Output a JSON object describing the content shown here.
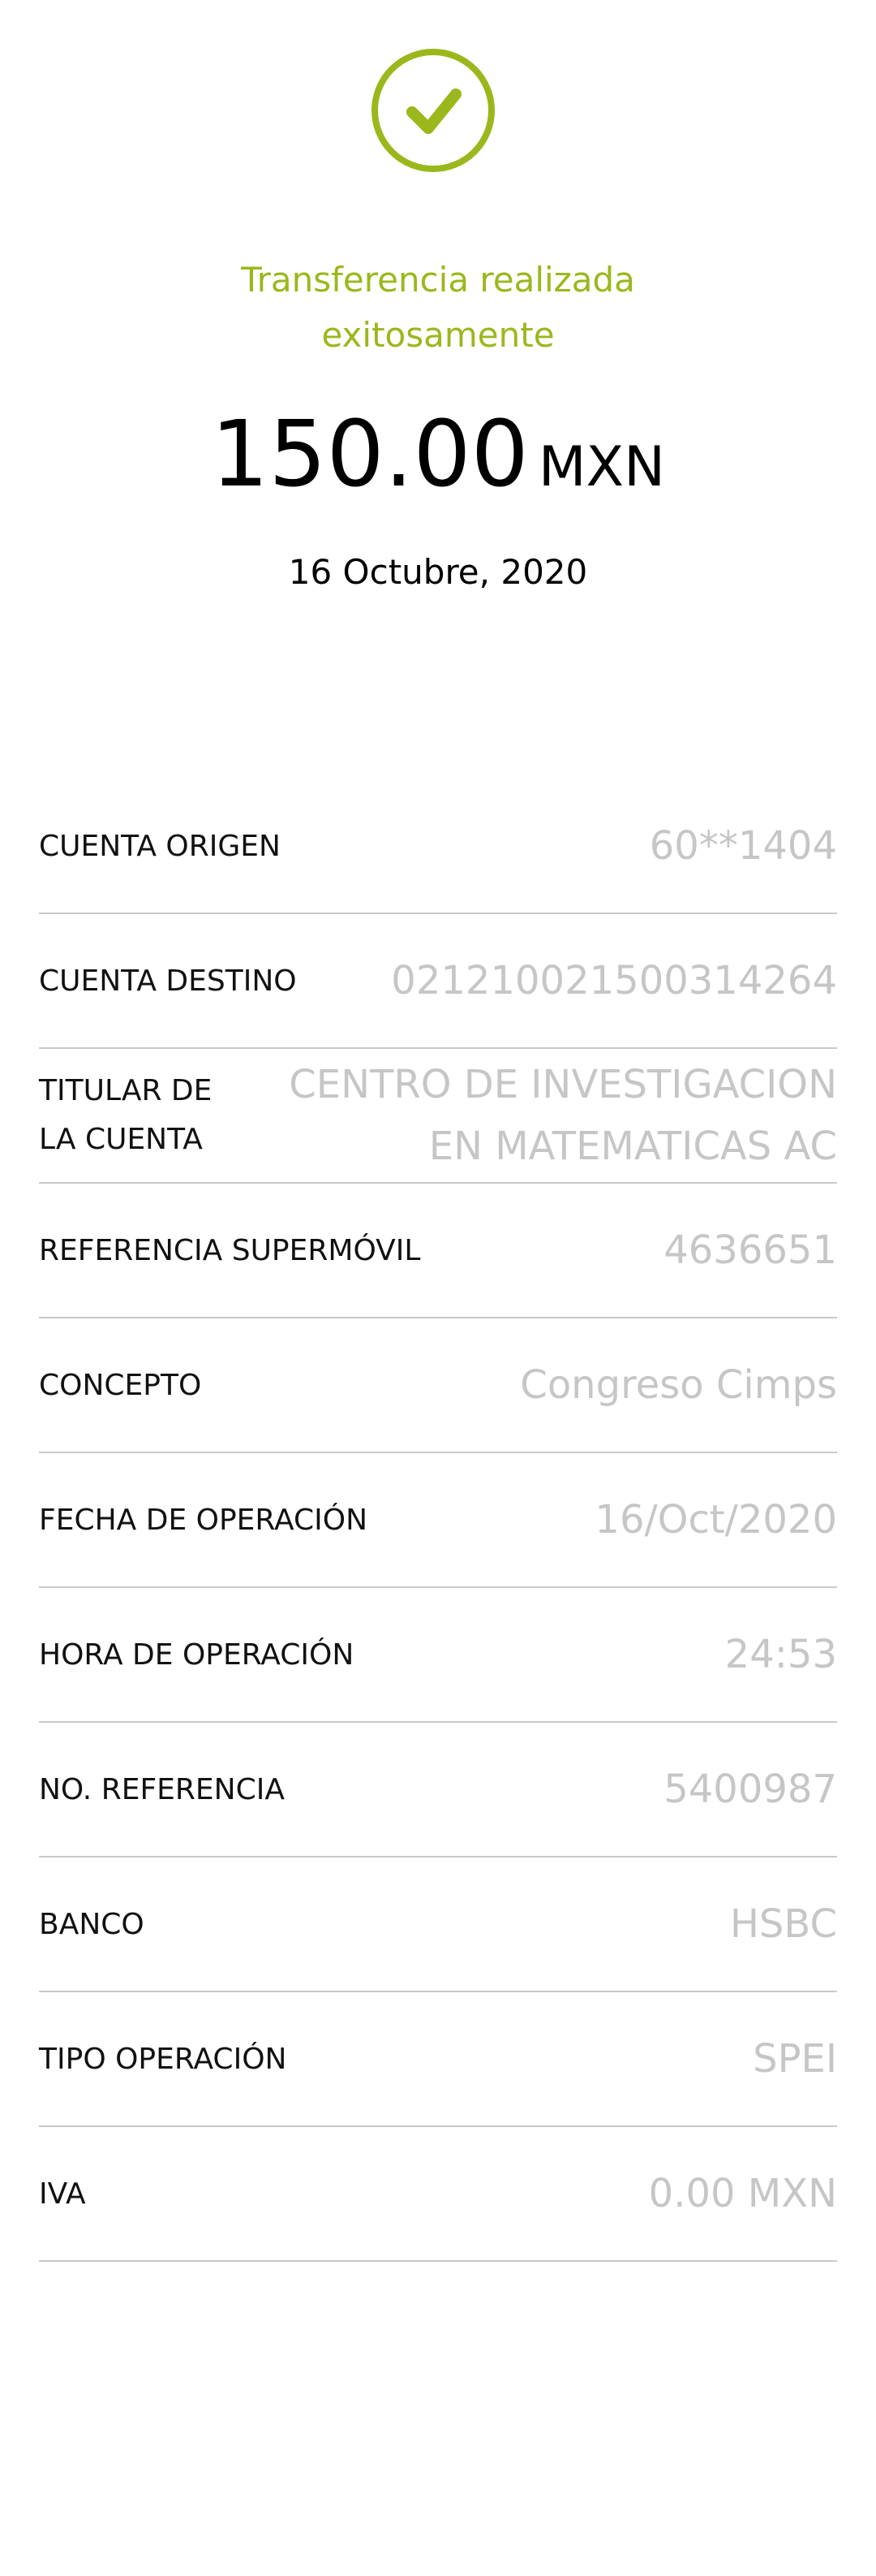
{
  "status": {
    "line1": "Transferencia realizada",
    "line2": "exitosamente",
    "icon": "check-circle-icon",
    "accent_color": "#9ab81c"
  },
  "amount": {
    "value": "150.00",
    "currency": "MXN"
  },
  "date": "16 Octubre, 2020",
  "details": [
    {
      "label": "CUENTA ORIGEN",
      "value": "60**1404"
    },
    {
      "label": "CUENTA DESTINO",
      "value": "021210021500314264"
    },
    {
      "label": "TITULAR DE LA CUENTA",
      "value": "CENTRO DE INVESTIGACION EN MATEMATICAS AC"
    },
    {
      "label": "REFERENCIA SUPERMÓVIL",
      "value": "4636651"
    },
    {
      "label": "CONCEPTO",
      "value": "Congreso Cimps"
    },
    {
      "label": "FECHA DE OPERACIÓN",
      "value": "16/Oct/2020"
    },
    {
      "label": "HORA DE OPERACIÓN",
      "value": "24:53"
    },
    {
      "label": "NO. REFERENCIA",
      "value": "5400987"
    },
    {
      "label": "BANCO",
      "value": "HSBC"
    },
    {
      "label": "TIPO OPERACIÓN",
      "value": "SPEI"
    },
    {
      "label": "IVA",
      "value": "0.00 MXN"
    }
  ]
}
